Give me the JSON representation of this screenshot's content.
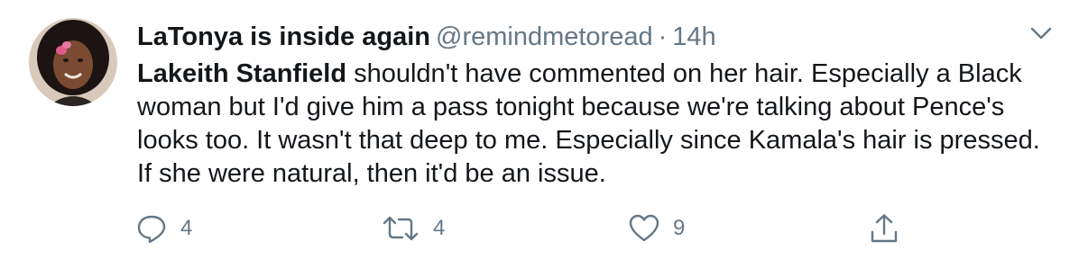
{
  "tweet": {
    "display_name": "LaTonya is inside again",
    "handle": "@remindmetoread",
    "separator": "·",
    "time": "14h",
    "mention": "Lakeith Stanfield",
    "text": " shouldn't have commented on her hair. Especially a Black woman but I'd give him a pass tonight because we're talking about Pence's looks too. It wasn't that deep to me. Especially since Kamala's hair is pressed. If she were natural, then it'd be an issue.",
    "actions": {
      "reply_count": "4",
      "retweet_count": "4",
      "like_count": "9"
    }
  },
  "colors": {
    "text": "#14171a",
    "secondary": "#657786",
    "icon": "#657786"
  },
  "icons": [
    "avatar",
    "chevron-down-icon",
    "reply-icon",
    "retweet-icon",
    "like-icon",
    "share-icon"
  ]
}
